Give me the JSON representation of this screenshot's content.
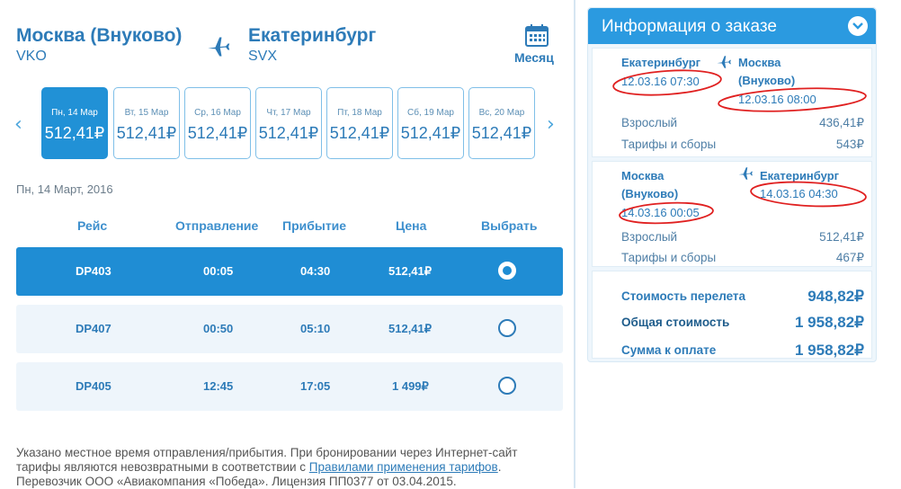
{
  "route": {
    "from_city": "Москва (Внуково)",
    "from_code": "VKO",
    "to_city": "Екатеринбург",
    "to_code": "SVX",
    "month_label": "Месяц"
  },
  "days": [
    {
      "date": "Пн, 14 Мар",
      "price": "512,41₽",
      "selected": true
    },
    {
      "date": "Вт, 15 Мар",
      "price": "512,41₽",
      "selected": false
    },
    {
      "date": "Ср, 16 Мар",
      "price": "512,41₽",
      "selected": false
    },
    {
      "date": "Чт, 17 Мар",
      "price": "512,41₽",
      "selected": false
    },
    {
      "date": "Пт, 18 Мар",
      "price": "512,41₽",
      "selected": false
    },
    {
      "date": "Сб, 19 Мар",
      "price": "512,41₽",
      "selected": false
    },
    {
      "date": "Вс, 20 Мар",
      "price": "512,41₽",
      "selected": false
    }
  ],
  "selected_date_label": "Пн, 14 Март, 2016",
  "table": {
    "headers": [
      "Рейс",
      "Отправление",
      "Прибытие",
      "Цена",
      "Выбрать"
    ],
    "rows": [
      {
        "flight": "DP403",
        "dep": "00:05",
        "arr": "04:30",
        "price": "512,41₽",
        "selected": true
      },
      {
        "flight": "DP407",
        "dep": "00:50",
        "arr": "05:10",
        "price": "512,41₽",
        "selected": false
      },
      {
        "flight": "DP405",
        "dep": "12:45",
        "arr": "17:05",
        "price": "1 499₽",
        "selected": false
      }
    ]
  },
  "footnote": {
    "line1": "Указано местное время отправления/прибытия. При бронировании через Интернет-сайт",
    "line2_pre": "тарифы являются невозвратными в соответствии с ",
    "line2_link": "Правилами применения тарифов",
    "line2_post": ".",
    "line3": "Перевозчик ООО «Авиакомпания «Победа». Лицензия ПП0377 от 03.04.2015."
  },
  "order": {
    "title": "Информация о заказе",
    "leg1": {
      "from": "Екатеринбург",
      "from_time": "12.03.16 07:30",
      "to_line1": "Москва",
      "to_line2": "(Внуково)",
      "to_time": "12.03.16 08:00",
      "adult_label": "Взрослый",
      "adult_value": "436,41₽",
      "fees_label": "Тарифы и сборы",
      "fees_value": "543₽"
    },
    "leg2": {
      "from_line1": "Москва",
      "from_line2": "(Внуково)",
      "from_time": "14.03.16 00:05",
      "to": "Екатеринбург",
      "to_time": "14.03.16 04:30",
      "adult_label": "Взрослый",
      "adult_value": "512,41₽",
      "fees_label": "Тарифы и сборы",
      "fees_value": "467₽"
    },
    "totals": {
      "flight_cost_label": "Стоимость перелета",
      "flight_cost_value": "948,82₽",
      "total_label": "Общая стоимость",
      "total_value": "1 958,82₽",
      "due_label": "Сумма к оплате",
      "due_value": "1 958,82₽"
    }
  },
  "colors": {
    "accent": "#2b9ae0",
    "selected": "#1f8dd4",
    "text_blue": "#2d7bb8",
    "annotation_red": "#e02020"
  }
}
